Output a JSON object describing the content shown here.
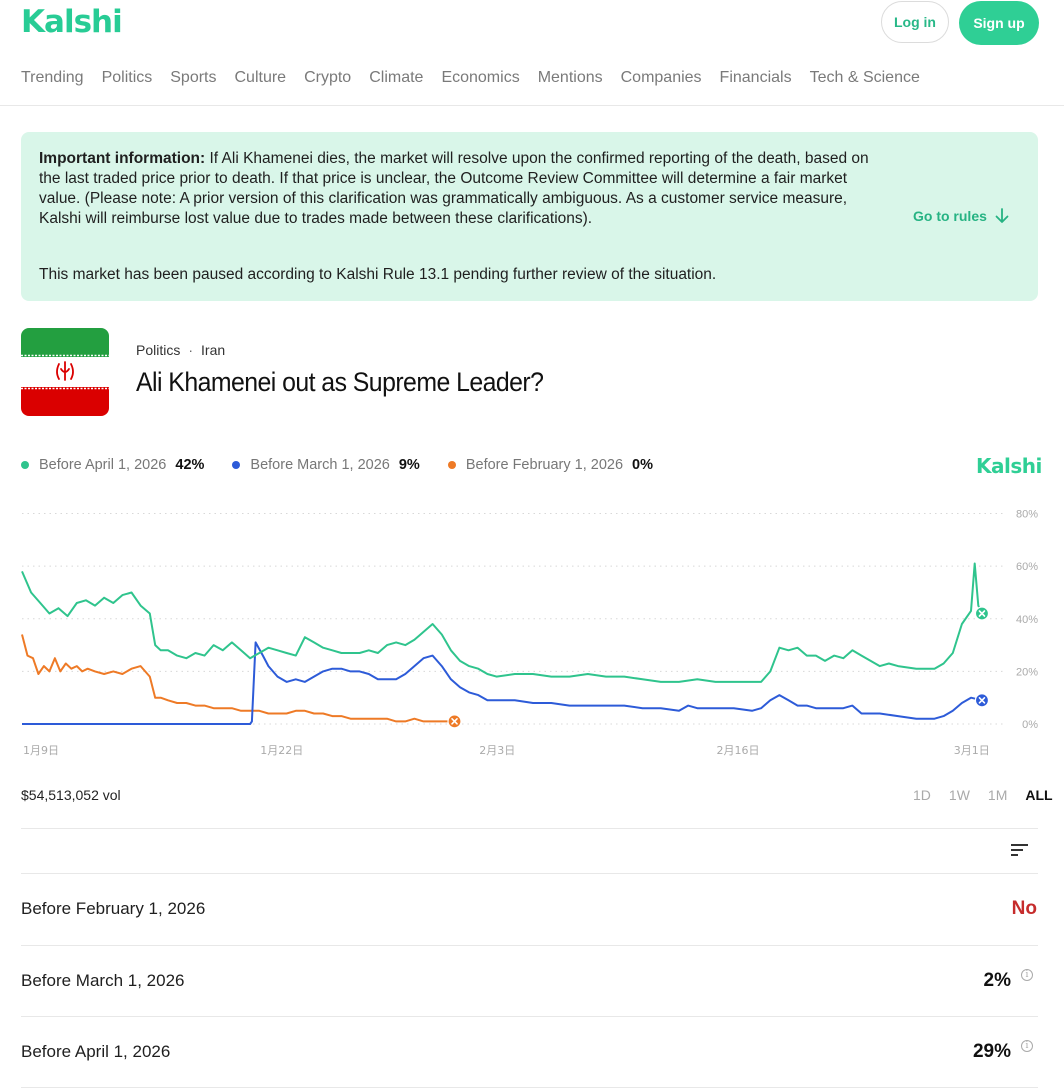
{
  "brand": {
    "name": "Kalshi",
    "color": "#28cc95"
  },
  "header": {
    "login_label": "Log in",
    "signup_label": "Sign up"
  },
  "nav": [
    "Trending",
    "Politics",
    "Sports",
    "Culture",
    "Crypto",
    "Climate",
    "Economics",
    "Mentions",
    "Companies",
    "Financials",
    "Tech & Science"
  ],
  "notice": {
    "heading": "Important information:",
    "body": " If Ali Khamenei dies, the market will resolve upon the confirmed reporting of the death, based on the last traded price prior to death. If that price is unclear, the Outcome Review Committee will determine a fair market value. (Please note: A prior version of this clarification was grammatically ambiguous. As a customer service measure, Kalshi will reimburse lost value due to trades made between these clarifications).",
    "paused": "This market has been paused according to Kalshi Rule 13.1 pending further review of the situation.",
    "rules_link": "Go to rules",
    "rules_icon": "arrow-down-icon"
  },
  "market": {
    "category": "Politics",
    "subcategory": "Iran",
    "title": "Ali Khamenei out as Supreme Leader?",
    "image": "iran-flag"
  },
  "legend": [
    {
      "label": "Before April 1, 2026",
      "value": "42%",
      "color": "#2fc48d"
    },
    {
      "label": "Before March 1, 2026",
      "value": "9%",
      "color": "#2d5bd8"
    },
    {
      "label": "Before February 1, 2026",
      "value": "0%",
      "color": "#ee7a26"
    }
  ],
  "chart_watermark": "Kalshi",
  "chart_data": {
    "type": "line",
    "y_ticks": [
      "80%",
      "60%",
      "40%",
      "20%",
      "0%"
    ],
    "ylim": [
      0,
      80
    ],
    "x_ticks": [
      {
        "label": "1月9日",
        "day": 0
      },
      {
        "label": "1月22日",
        "day": 13
      },
      {
        "label": "2月3日",
        "day": 25
      },
      {
        "label": "2月16日",
        "day": 38
      },
      {
        "label": "3月1日",
        "day": 51
      }
    ],
    "grid": true,
    "series": [
      {
        "name": "Before April 1, 2026",
        "color": "#2fc48d",
        "end_marker": true,
        "points": [
          [
            0,
            58
          ],
          [
            0.5,
            50
          ],
          [
            1,
            46
          ],
          [
            1.5,
            42
          ],
          [
            2,
            44
          ],
          [
            2.5,
            41
          ],
          [
            3,
            46
          ],
          [
            3.5,
            47
          ],
          [
            4,
            45
          ],
          [
            4.5,
            48
          ],
          [
            5,
            46
          ],
          [
            5.5,
            49
          ],
          [
            6,
            50
          ],
          [
            6.5,
            45
          ],
          [
            7,
            42
          ],
          [
            7.3,
            30
          ],
          [
            7.6,
            28
          ],
          [
            8,
            28
          ],
          [
            8.5,
            26
          ],
          [
            9,
            25
          ],
          [
            9.5,
            27
          ],
          [
            10,
            26
          ],
          [
            10.5,
            30
          ],
          [
            11,
            28
          ],
          [
            11.5,
            31
          ],
          [
            12,
            28
          ],
          [
            12.5,
            25
          ],
          [
            13,
            27
          ],
          [
            13.5,
            29
          ],
          [
            14,
            28
          ],
          [
            14.5,
            27
          ],
          [
            15,
            26
          ],
          [
            15.5,
            33
          ],
          [
            16,
            31
          ],
          [
            16.5,
            29
          ],
          [
            17,
            28
          ],
          [
            17.5,
            27
          ],
          [
            18,
            27
          ],
          [
            18.5,
            27
          ],
          [
            19,
            28
          ],
          [
            19.5,
            27
          ],
          [
            20,
            30
          ],
          [
            20.5,
            31
          ],
          [
            21,
            30
          ],
          [
            21.5,
            32
          ],
          [
            22,
            35
          ],
          [
            22.5,
            38
          ],
          [
            23,
            34
          ],
          [
            23.5,
            28
          ],
          [
            24,
            24
          ],
          [
            24.5,
            22
          ],
          [
            25,
            21
          ],
          [
            25.5,
            19
          ],
          [
            26,
            18
          ],
          [
            27,
            19
          ],
          [
            28,
            19
          ],
          [
            29,
            18
          ],
          [
            30,
            18
          ],
          [
            31,
            19
          ],
          [
            32,
            18
          ],
          [
            33,
            18
          ],
          [
            34,
            17
          ],
          [
            35,
            16
          ],
          [
            36,
            16
          ],
          [
            37,
            17
          ],
          [
            38,
            16
          ],
          [
            39,
            16
          ],
          [
            40,
            16
          ],
          [
            40.5,
            16
          ],
          [
            41,
            20
          ],
          [
            41.5,
            29
          ],
          [
            42,
            28
          ],
          [
            42.5,
            29
          ],
          [
            43,
            26
          ],
          [
            43.5,
            26
          ],
          [
            44,
            24
          ],
          [
            44.5,
            26
          ],
          [
            45,
            25
          ],
          [
            45.5,
            28
          ],
          [
            46,
            26
          ],
          [
            47,
            22
          ],
          [
            47.5,
            23
          ],
          [
            48,
            22
          ],
          [
            49,
            21
          ],
          [
            50,
            21
          ],
          [
            50.5,
            23
          ],
          [
            51,
            27
          ],
          [
            51.5,
            38
          ],
          [
            52,
            43
          ],
          [
            52.2,
            61
          ],
          [
            52.4,
            45
          ],
          [
            52.6,
            42
          ]
        ]
      },
      {
        "name": "Before March 1, 2026",
        "color": "#2d5bd8",
        "end_marker": true,
        "points": [
          [
            0,
            0
          ],
          [
            12.5,
            0
          ],
          [
            12.6,
            1
          ],
          [
            12.8,
            31
          ],
          [
            13.2,
            26
          ],
          [
            13.5,
            22
          ],
          [
            14,
            18
          ],
          [
            14.5,
            16
          ],
          [
            15,
            17
          ],
          [
            15.5,
            16
          ],
          [
            16,
            18
          ],
          [
            16.5,
            20
          ],
          [
            17,
            21
          ],
          [
            17.5,
            21
          ],
          [
            18,
            20
          ],
          [
            18.5,
            20
          ],
          [
            19,
            19
          ],
          [
            19.5,
            17
          ],
          [
            20,
            17
          ],
          [
            20.5,
            17
          ],
          [
            21,
            19
          ],
          [
            21.5,
            22
          ],
          [
            22,
            25
          ],
          [
            22.5,
            26
          ],
          [
            23,
            22
          ],
          [
            23.5,
            17
          ],
          [
            24,
            14
          ],
          [
            24.5,
            12
          ],
          [
            25,
            11
          ],
          [
            25.5,
            9
          ],
          [
            26,
            9
          ],
          [
            27,
            9
          ],
          [
            28,
            8
          ],
          [
            29,
            8
          ],
          [
            30,
            7
          ],
          [
            31,
            7
          ],
          [
            32,
            7
          ],
          [
            33,
            7
          ],
          [
            34,
            6
          ],
          [
            35,
            6
          ],
          [
            36,
            5
          ],
          [
            36.5,
            7
          ],
          [
            37,
            6
          ],
          [
            38,
            6
          ],
          [
            39,
            6
          ],
          [
            40,
            5
          ],
          [
            40.5,
            6
          ],
          [
            41,
            9
          ],
          [
            41.5,
            11
          ],
          [
            42,
            9
          ],
          [
            42.5,
            7
          ],
          [
            43,
            7
          ],
          [
            43.5,
            6
          ],
          [
            44,
            6
          ],
          [
            45,
            6
          ],
          [
            45.5,
            7
          ],
          [
            46,
            4
          ],
          [
            47,
            4
          ],
          [
            48,
            3
          ],
          [
            49,
            2
          ],
          [
            50,
            2
          ],
          [
            50.5,
            3
          ],
          [
            51,
            5
          ],
          [
            51.5,
            8
          ],
          [
            52,
            10
          ],
          [
            52.6,
            9
          ]
        ]
      },
      {
        "name": "Before February 1, 2026",
        "color": "#ee7a26",
        "end_marker": true,
        "points": [
          [
            0,
            34
          ],
          [
            0.3,
            26
          ],
          [
            0.6,
            25
          ],
          [
            0.9,
            19
          ],
          [
            1.2,
            22
          ],
          [
            1.5,
            20
          ],
          [
            1.8,
            25
          ],
          [
            2.1,
            20
          ],
          [
            2.4,
            23
          ],
          [
            2.7,
            21
          ],
          [
            3,
            22
          ],
          [
            3.3,
            20
          ],
          [
            3.6,
            21
          ],
          [
            4,
            20
          ],
          [
            4.5,
            19
          ],
          [
            5,
            20
          ],
          [
            5.5,
            19
          ],
          [
            6,
            21
          ],
          [
            6.5,
            22
          ],
          [
            7,
            18
          ],
          [
            7.3,
            10
          ],
          [
            7.6,
            10
          ],
          [
            8,
            9
          ],
          [
            8.5,
            8
          ],
          [
            9,
            8
          ],
          [
            9.5,
            7
          ],
          [
            10,
            7
          ],
          [
            10.5,
            6
          ],
          [
            11,
            6
          ],
          [
            11.5,
            6
          ],
          [
            12,
            5
          ],
          [
            12.5,
            5
          ],
          [
            13,
            5
          ],
          [
            13.5,
            4
          ],
          [
            14,
            4
          ],
          [
            14.5,
            4
          ],
          [
            15,
            5
          ],
          [
            15.5,
            5
          ],
          [
            16,
            4
          ],
          [
            16.5,
            4
          ],
          [
            17,
            3
          ],
          [
            17.5,
            3
          ],
          [
            18,
            2
          ],
          [
            18.5,
            2
          ],
          [
            19,
            2
          ],
          [
            19.5,
            2
          ],
          [
            20,
            2
          ],
          [
            20.5,
            1
          ],
          [
            21,
            1
          ],
          [
            21.5,
            2
          ],
          [
            22,
            1
          ],
          [
            22.5,
            1
          ],
          [
            23,
            1
          ],
          [
            23.7,
            1
          ]
        ]
      }
    ]
  },
  "volume": "$54,513,052 vol",
  "ranges": [
    "1D",
    "1W",
    "1M",
    "ALL"
  ],
  "active_range": "ALL",
  "outcomes": [
    {
      "label": "Before February 1, 2026",
      "value": "No",
      "status": "resolved"
    },
    {
      "label": "Before March 1, 2026",
      "value": "2%"
    },
    {
      "label": "Before April 1, 2026",
      "value": "29%"
    }
  ]
}
